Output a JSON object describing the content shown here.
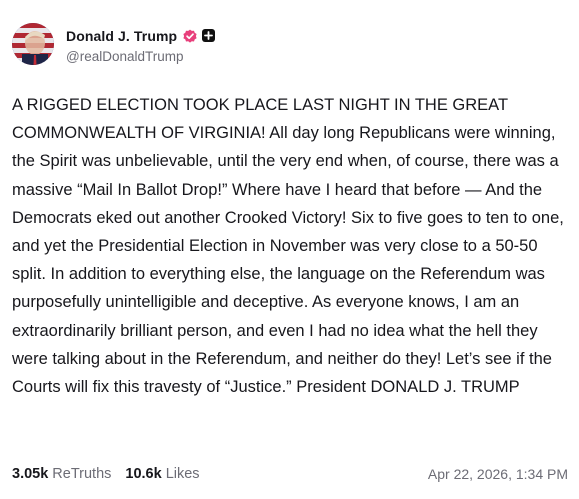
{
  "author": {
    "display_name": "Donald J. Trump",
    "handle": "@realDonaldTrump",
    "verified_badge_color": "#e8407c"
  },
  "post": {
    "text": "A RIGGED ELECTION TOOK PLACE LAST NIGHT IN THE GREAT COMMONWEALTH OF VIRGINIA! All day long Republicans were winning, the Spirit was unbelievable, until the very end when, of course, there was a massive “Mail In Ballot Drop!” Where have I heard that before — And the Democrats eked out another Crooked Victory! Six to five goes to ten to one, and yet the Presidential Election in November was very close to a 50-50 split. In addition to everything else, the language on the Referendum was purposefully unintelligible and deceptive. As everyone knows, I am an extraordinarily brilliant person, and even I had no idea what the hell they were talking about in the Referendum, and neither do they! Let’s see if the Courts will fix this travesty of “Justice.” President DONALD J. TRUMP"
  },
  "stats": {
    "retruths_count": "3.05k",
    "retruths_label": "ReTruths",
    "likes_count": "10.6k",
    "likes_label": "Likes"
  },
  "timestamp": "Apr 22, 2026, 1:34 PM",
  "icons": {
    "verified": "verified-check-icon",
    "follow": "plus-icon"
  }
}
